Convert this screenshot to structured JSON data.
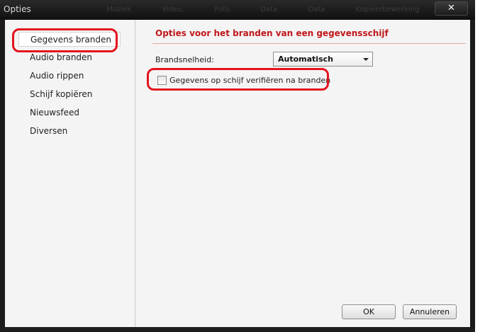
{
  "window": {
    "title": "Opties",
    "close_label": "✕"
  },
  "background_tabs": [
    "Muziek",
    "Video, Foto",
    "Data",
    "Data",
    "Kopieerbewerking"
  ],
  "sidebar": {
    "items": [
      {
        "label": "Gegevens branden",
        "selected": true
      },
      {
        "label": "Audio branden"
      },
      {
        "label": "Audio rippen"
      },
      {
        "label": "Schijf kopiëren"
      },
      {
        "label": "Nieuwsfeed"
      },
      {
        "label": "Diversen"
      }
    ]
  },
  "main": {
    "heading": "Opties voor het branden van een gegevensschijf",
    "speed_label": "Brandsnelheid:",
    "speed_value": "Automatisch",
    "verify_label": "Gegevens op schijf verifiëren na branden",
    "verify_checked": false
  },
  "buttons": {
    "ok": "OK",
    "cancel": "Annuleren"
  },
  "colors": {
    "heading": "#c0171a",
    "highlight": "#e3141e",
    "titlebar": "#1b1b1b"
  }
}
